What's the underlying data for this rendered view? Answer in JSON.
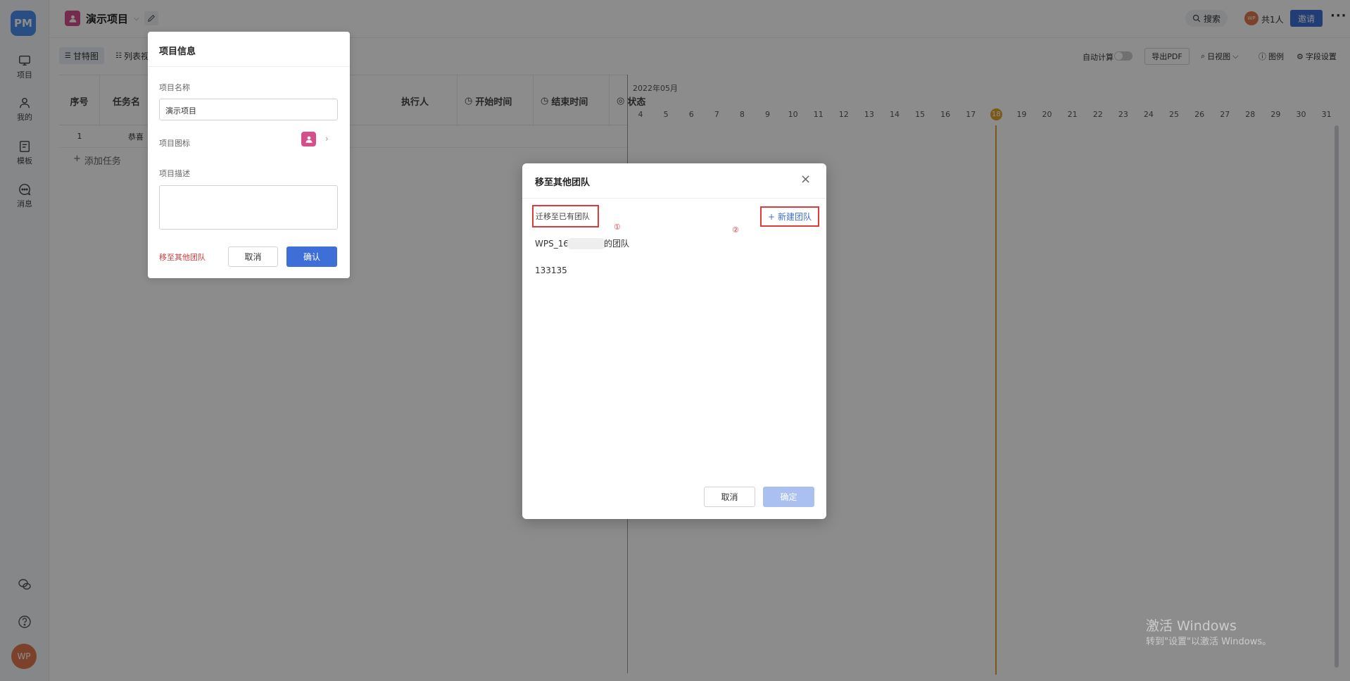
{
  "sidebar": {
    "logo": "PM",
    "items": [
      {
        "label": "项目",
        "icon": "monitor-icon"
      },
      {
        "label": "我的",
        "icon": "user-icon"
      },
      {
        "label": "模板",
        "icon": "template-icon"
      },
      {
        "label": "消息",
        "icon": "message-icon"
      }
    ],
    "avatar": "WP"
  },
  "header": {
    "project_name": "演示项目",
    "search_label": "搜索",
    "member_avatar": "WP",
    "member_count": "共1人",
    "invite_label": "邀请",
    "more_label": "···"
  },
  "toolbar": {
    "views": [
      "甘特图",
      "列表视"
    ],
    "auto_calc_label": "自动计算",
    "export_pdf": "导出PDF",
    "day_view": "日视图",
    "legend": "图例",
    "field_settings": "字段设置"
  },
  "grid": {
    "columns": [
      "序号",
      "任务名",
      "执行人",
      "开始时间",
      "结束时间",
      "状态"
    ],
    "rows": [
      {
        "index": "1",
        "name": "恭喜"
      }
    ],
    "add_task": "添加任务"
  },
  "gantt": {
    "month": "2022年05月",
    "days": [
      "4",
      "5",
      "6",
      "7",
      "8",
      "9",
      "10",
      "11",
      "12",
      "13",
      "14",
      "15",
      "16",
      "17",
      "18",
      "19",
      "20",
      "21",
      "22",
      "23",
      "24",
      "25",
      "26",
      "27",
      "28",
      "29",
      "30",
      "31"
    ],
    "today": "18",
    "today_color": "#e3a22a"
  },
  "project_panel": {
    "title": "项目信息",
    "name_label": "项目名称",
    "name_value": "演示项目",
    "icon_label": "项目图标",
    "desc_label": "项目描述",
    "desc_value": "",
    "move_link": "移至其他团队",
    "cancel": "取消",
    "confirm": "确认"
  },
  "modal": {
    "title": "移至其他团队",
    "section_label": "迁移至已有团队",
    "new_team": "新建团队",
    "marker_1": "①",
    "marker_2": "②",
    "teams": [
      {
        "prefix": "WPS_16",
        "suffix": "的团队"
      },
      {
        "prefix": "133135",
        "suffix": ""
      }
    ],
    "cancel": "取消",
    "confirm": "确定",
    "highlight_color": "#e03a3a",
    "accent_color": "#3e6fd8"
  },
  "watermark": {
    "line1": "激活 Windows",
    "line2": "转到\"设置\"以激活 Windows。"
  }
}
